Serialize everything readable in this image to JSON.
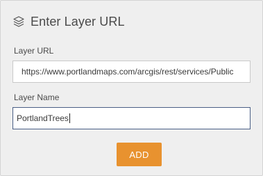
{
  "dialog": {
    "title": "Enter Layer URL",
    "title_icon": "layers-icon"
  },
  "layer_url": {
    "label": "Layer URL",
    "value": "https://www.portlandmaps.com/arcgis/rest/services/Public"
  },
  "layer_name": {
    "label": "Layer Name",
    "value": "PortlandTrees"
  },
  "actions": {
    "add_label": "ADD"
  },
  "colors": {
    "panel_bg": "#efefef",
    "accent_button": "#e8922f",
    "focused_border": "#4a5f86"
  }
}
